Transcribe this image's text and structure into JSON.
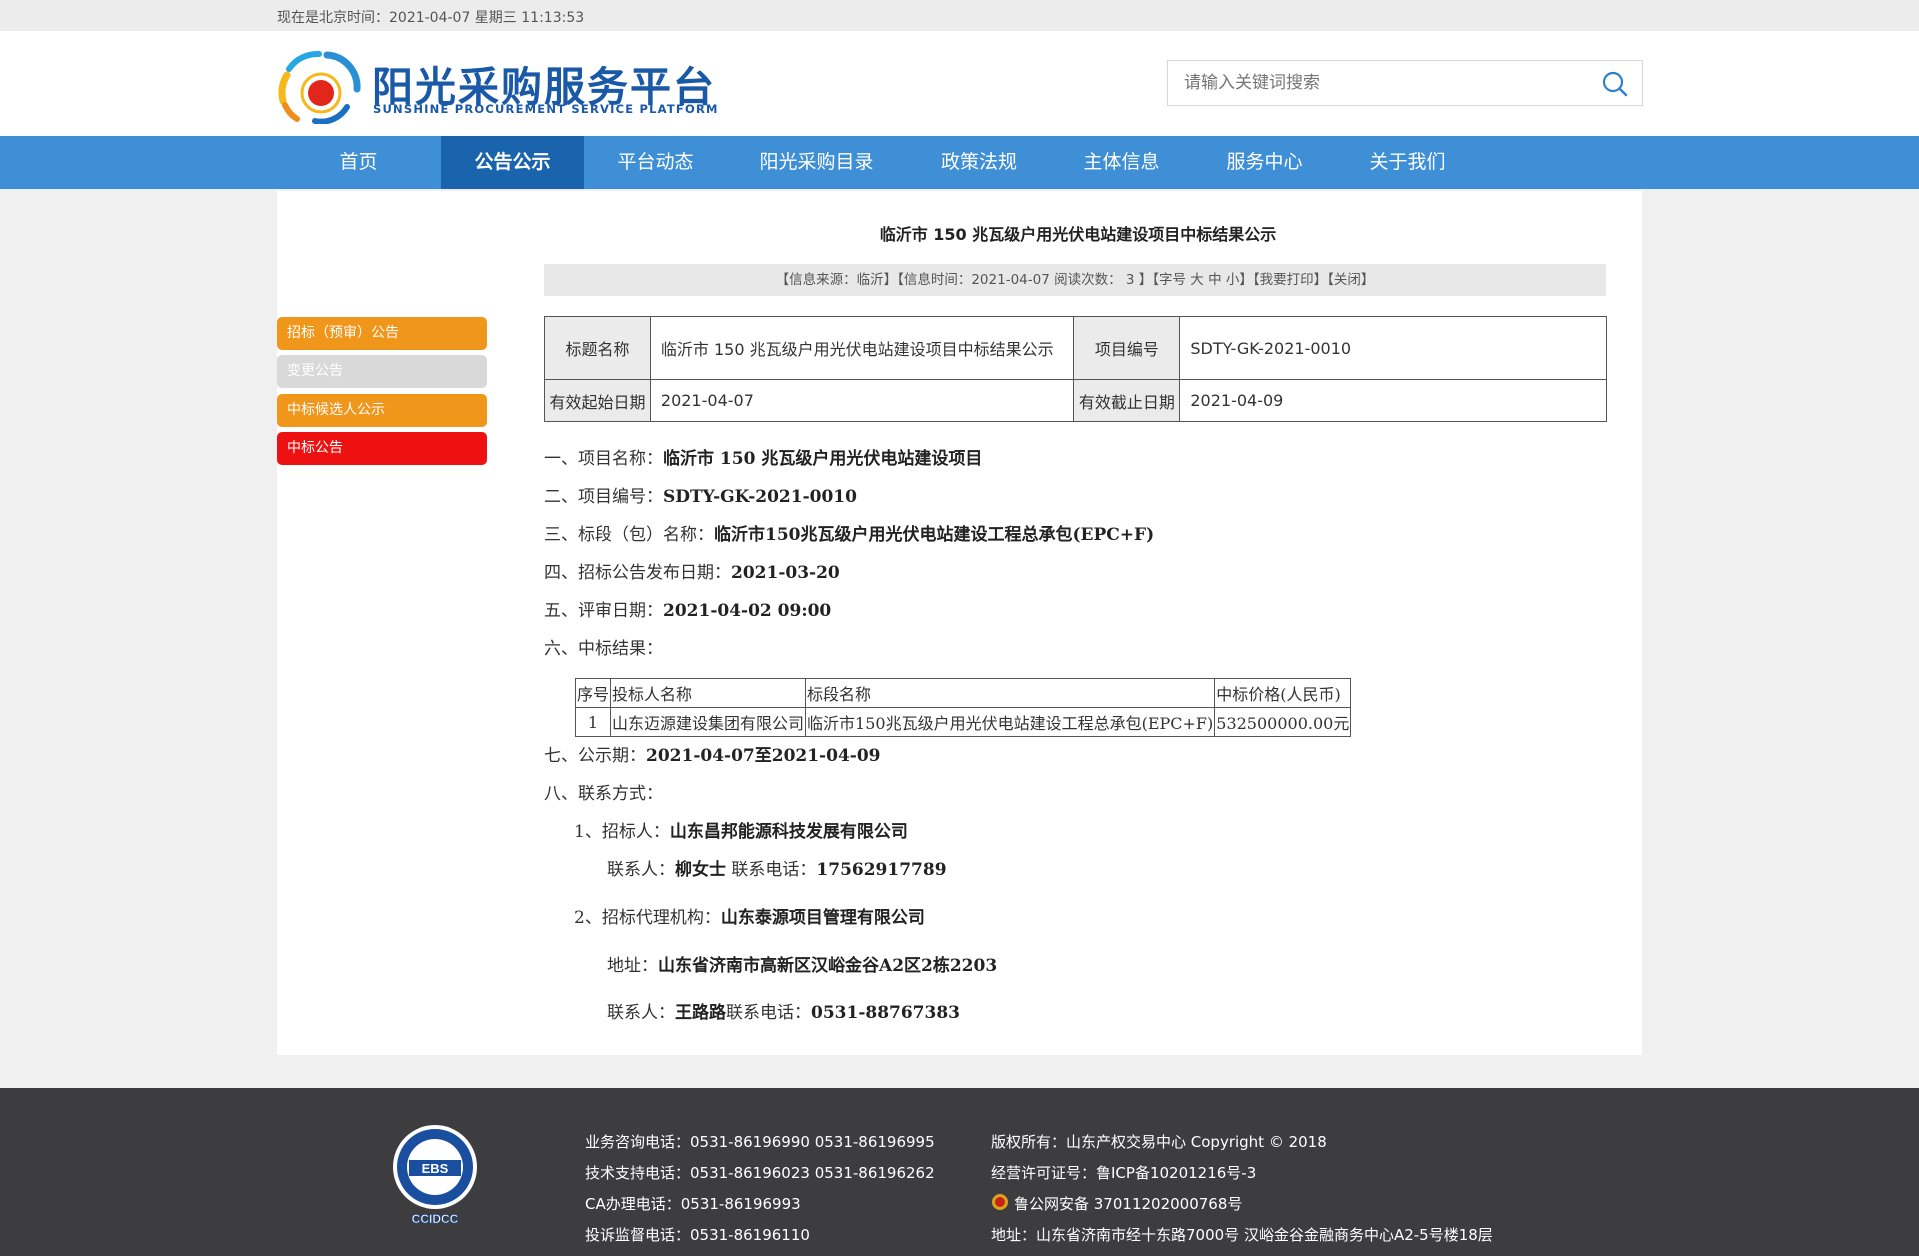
{
  "topbar": {
    "time_text": "现在是北京时间：2021-04-07  星期三  11:13:53"
  },
  "logo": {
    "title": "阳光采购服务平台",
    "subtitle": "SUNSHINE PROCUREMENT SERVICE PLATFORM"
  },
  "search": {
    "placeholder": "请输入关键词搜索",
    "icon": "search-icon"
  },
  "nav": {
    "items": [
      {
        "label": "首页",
        "active": false
      },
      {
        "label": "公告公示",
        "active": true
      },
      {
        "label": "平台动态",
        "active": false
      },
      {
        "label": "阳光采购目录",
        "active": false
      },
      {
        "label": "政策法规",
        "active": false
      },
      {
        "label": "主体信息",
        "active": false
      },
      {
        "label": "服务中心",
        "active": false
      },
      {
        "label": "关于我们",
        "active": false
      }
    ],
    "color": "#3f8fd6",
    "active_color": "#1a63ad"
  },
  "sidebar": {
    "items": [
      {
        "label": "招标（预审）公告",
        "color": "#f0961b"
      },
      {
        "label": "变更公告",
        "color": "#d9d9d9"
      },
      {
        "label": "中标候选人公示",
        "color": "#f0961b"
      },
      {
        "label": "中标公告",
        "color": "#ee1111"
      }
    ]
  },
  "article": {
    "title": "临沂市 150 兆瓦级户用光伏电站建设项目中标结果公示",
    "info": {
      "source": "【信息来源：临沂】",
      "time": "【信息时间：2021-04-07  阅读次数：  3  】",
      "font_size": "【字号 大 中 小】",
      "print": "【我要打印】",
      "close": "【关闭】"
    },
    "meta": {
      "title_label": "标题名称",
      "title_value": "临沂市 150 兆瓦级户用光伏电站建设项目中标结果公示",
      "code_label": "项目编号",
      "code_value": "SDTY-GK-2021-0010",
      "start_label": "有效起始日期",
      "start_value": "2021-04-07",
      "end_label": "有效截止日期",
      "end_value": "2021-04-09"
    },
    "items": {
      "l1_label": "一、项目名称：",
      "l1_value": "临沂市  150  兆瓦级户用光伏电站建设项目",
      "l2_label": "二、项目编号：",
      "l2_value": "SDTY-GK-2021-0010",
      "l3_label": "三、标段（包）名称：",
      "l3_value": "临沂市150兆瓦级户用光伏电站建设工程总承包(EPC+F)",
      "l4_label": "四、招标公告发布日期：",
      "l4_value": "2021-03-20",
      "l5_label": "五、评审日期：",
      "l5_value": "2021-04-02  09:00",
      "l6_label": "六、中标结果：",
      "l7_label": "七、公示期：",
      "l7_value": "2021-04-07至2021-04-09",
      "l8_label": "八、联系方式："
    },
    "results": {
      "headers": [
        "序号",
        "投标人名称",
        "标段名称",
        "中标价格(人民币)"
      ],
      "rows": [
        [
          "1",
          "山东迈源建设集团有限公司",
          "临沂市150兆瓦级户用光伏电站建设工程总承包(EPC+F)",
          "532500000.00元"
        ]
      ]
    },
    "contact": {
      "c1_label": "1、招标人：",
      "c1_value": "山东昌邦能源科技发展有限公司",
      "c1_person_label": "联系人：",
      "c1_person": "柳女士",
      "c1_phone_label": "  联系电话：",
      "c1_phone": "17562917789",
      "c2_label": "2、招标代理机构：",
      "c2_value": "山东泰源项目管理有限公司",
      "c2_addr_label": "地址：",
      "c2_addr": "山东省济南市高新区汉峪金谷A2区2栋2203",
      "c2_person_label": "联系人：",
      "c2_person": "王路路",
      "c2_phone_label": "联系电话：",
      "c2_phone": "0531-88767383"
    }
  },
  "footer": {
    "badge_top": "EBS",
    "badge_bottom": "CCIDCC",
    "col1": [
      "业务咨询电话：0531-86196990 0531-86196995",
      "技术支持电话：0531-86196023 0531-86196262",
      "CA办理电话：0531-86196993",
      "投诉监督电话：0531-86196110"
    ],
    "col2": [
      "版权所有：山东产权交易中心 Copyright © 2018",
      "经营许可证号：鲁ICP备10201216号-3",
      "鲁公网安备 37011202000768号",
      "地址：山东省济南市经十东路7000号 汉峪金谷金融商务中心A2-5号楼18层"
    ]
  }
}
